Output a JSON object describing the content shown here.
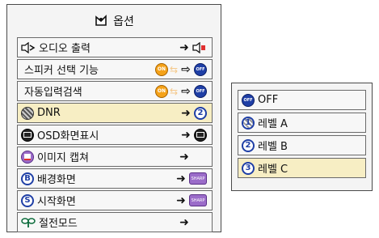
{
  "menu": {
    "title": "옵션",
    "title_icon": "options-icon",
    "items": [
      {
        "label": "오디오 출력",
        "icon": "audio-output-icon"
      },
      {
        "label": "스피커 선택 기능",
        "right_on": "ON",
        "right_off": "OFF"
      },
      {
        "label": "자동입력검색",
        "right_on": "ON",
        "right_off": "OFF"
      },
      {
        "label": "DNR",
        "icon": "dnr-icon",
        "right_value": "2"
      },
      {
        "label": "OSD화면표시",
        "icon": "osd-icon"
      },
      {
        "label": "이미지 캡쳐",
        "icon": "image-capture-icon"
      },
      {
        "label": "배경화면",
        "icon": "background-icon",
        "icon_text": "B",
        "right_tag": "SHARP"
      },
      {
        "label": "시작화면",
        "icon": "startup-screen-icon",
        "icon_text": "S",
        "right_tag": "SHARP"
      },
      {
        "label": "절전모드",
        "icon": "power-save-icon"
      }
    ]
  },
  "submenu": {
    "items": [
      {
        "label": "OFF",
        "icon_text": "OFF"
      },
      {
        "label": "레벨 A",
        "icon_text": "1"
      },
      {
        "label": "레벨 B",
        "icon_text": "2"
      },
      {
        "label": "레벨 C",
        "icon_text": "3"
      }
    ]
  },
  "colors": {
    "selected": "#f7eec4",
    "accent": "#1f3fa6",
    "on_badge": "#f5a219",
    "tag": "#9b6cc9"
  }
}
